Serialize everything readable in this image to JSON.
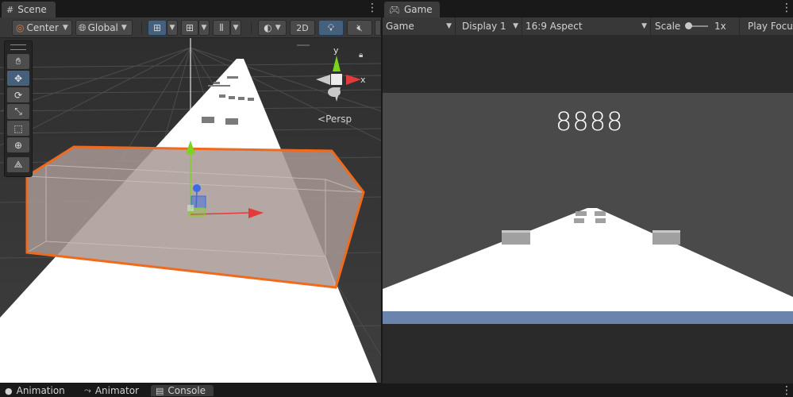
{
  "scene": {
    "tab_label": "Scene",
    "pivot_label": "Center",
    "space_label": "Global",
    "mode_2d_label": "2D",
    "persp_label": "Persp",
    "gizmo_axes": {
      "x": "x",
      "y": "y"
    },
    "tools": [
      "hand-tool",
      "move-tool",
      "rotate-tool",
      "scale-tool",
      "rect-tool",
      "transform-tool",
      "custom-tool"
    ]
  },
  "game": {
    "tab_label": "Game",
    "view_select": "Game",
    "display_select": "Display 1",
    "aspect_select": "16:9 Aspect",
    "scale_label": "Scale",
    "scale_value": "1x",
    "play_focus_label": "Play Focu",
    "score_text": "8888"
  },
  "bottom_tabs": [
    {
      "label": "Animation",
      "icon": "animation-icon"
    },
    {
      "label": "Animator",
      "icon": "animator-icon"
    },
    {
      "label": "Console",
      "icon": "console-icon"
    }
  ],
  "colors": {
    "selection_outline": "#f06a1e",
    "axis_x": "#e33b3b",
    "axis_y": "#7ad61d",
    "axis_z": "#3b6ce3",
    "active_tool": "#46607c",
    "game_sky": "#4a4a4a",
    "road": "#ffffff",
    "road_edge": "#6a84ac"
  }
}
